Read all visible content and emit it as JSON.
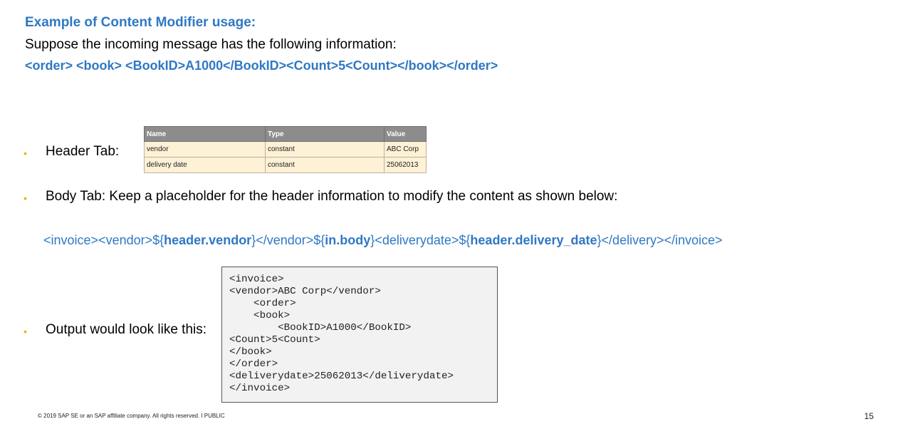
{
  "slide": {
    "title": "Example of Content Modifier usage:",
    "intro": "Suppose the incoming message has the following information:",
    "incoming_message": "<order> <book> <BookID>A1000</BookID><Count>5<Count></book></order>",
    "bullet_glyph": "•",
    "bullets": {
      "header_tab": "Header Tab:",
      "body_tab": "Body Tab: Keep a placeholder for the header information to modify the content as shown below:",
      "output": "Output would look like this:"
    },
    "header_table": {
      "columns": [
        "Name",
        "Type",
        "Value"
      ],
      "rows": [
        [
          "vendor",
          "constant",
          "ABC Corp"
        ],
        [
          "delivery date",
          "constant",
          "25062013"
        ]
      ]
    },
    "body_template": {
      "part1": "<invoice><vendor>${",
      "part2_bold": "header.vendor",
      "part3": "}</vendor>${",
      "part4_bold": "in.body",
      "part5": "}<deliverydate>${",
      "part6_bold": "header.delivery_date",
      "part7": "}</delivery></invoice>"
    },
    "output_lines": [
      "<invoice>",
      "<vendor>ABC Corp</vendor>",
      "    <order>",
      "    <book>",
      "        <BookID>A1000</BookID>",
      "<Count>5<Count>",
      "</book>",
      "</order>",
      "<deliverydate>25062013</deliverydate>",
      "</invoice>"
    ],
    "footer": "© 2019 SAP SE or an SAP affiliate company. All rights reserved.  ǀ  PUBLIC",
    "page_number": "15"
  },
  "colors": {
    "accent_blue": "#2f78c4",
    "bullet_orange": "#f0ab00",
    "table_header": "#8c8c8c",
    "table_cell": "#fdf1d6"
  }
}
